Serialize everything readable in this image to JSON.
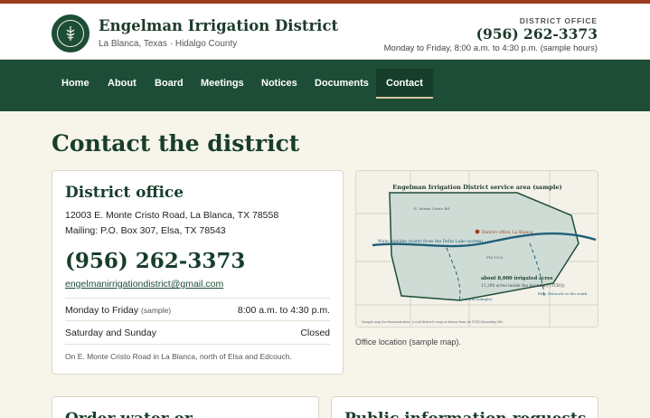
{
  "header": {
    "title": "Engelman Irrigation District",
    "subtitle": "La Blanca, Texas · Hidalgo County",
    "office_label": "DISTRICT OFFICE",
    "phone": "(956) 262-3373",
    "hours": "Monday to Friday, 8:00 a.m. to 4:30 p.m. (sample hours)",
    "seal_icon": "district-seal",
    "accent_color": "#9c3d1f",
    "brand_color": "#1d4d36"
  },
  "nav": {
    "items": [
      {
        "label": "Home"
      },
      {
        "label": "About"
      },
      {
        "label": "Board"
      },
      {
        "label": "Meetings"
      },
      {
        "label": "Notices"
      },
      {
        "label": "Documents"
      },
      {
        "label": "Contact",
        "active": true
      }
    ]
  },
  "page": {
    "title": "Contact the district"
  },
  "office_card": {
    "title": "District office",
    "address": "12003 E. Monte Cristo Road, La Blanca, TX 78558",
    "mailing": "Mailing: P.O. Box 307, Elsa, TX 78543",
    "phone": "(956) 262-3373",
    "email": "engelmanirrigationdistrict@gmail.com",
    "hours": [
      {
        "day": "Monday to Friday",
        "note": "(sample)",
        "time": "8:00 a.m. to 4:30 p.m."
      },
      {
        "day": "Saturday and Sunday",
        "note": "",
        "time": "Closed"
      }
    ],
    "directions": "On E. Monte Cristo Road in La Blanca, north of Elsa and Edcouch."
  },
  "map": {
    "title": "Engelman Irrigation District service area (sample)",
    "road_label": "E. Monte Cristo Rd",
    "office_label": "District office, La Blanca",
    "pipeline_label": "Main pipeline (water from the Delta Lake system)",
    "fm_label": "FM 1925",
    "acres_label": "about 8,000 irrigated acres",
    "tceq_label": "11,290 acres inside the boundary (TCEQ)",
    "lateral_label": "Lateral (sample)",
    "elsa_label": "Elsa, Edcouch to the south",
    "footnote": "Sample map for demonstration. A real district's map is drawn from its TCEQ boundary file.",
    "caption": "Office location (sample map)."
  },
  "cards_below": [
    {
      "title": "Order water or"
    },
    {
      "title": "Public information requests"
    }
  ]
}
